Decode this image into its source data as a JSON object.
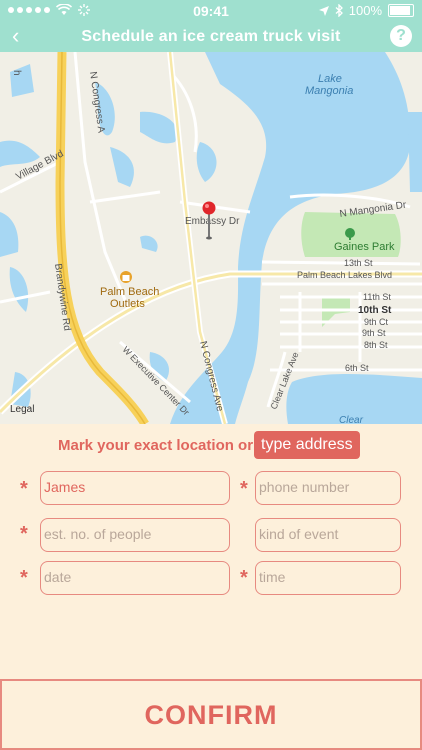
{
  "status_bar": {
    "time": "09:41",
    "battery_text": "100%",
    "battery_level": 1.0
  },
  "nav": {
    "back_icon": "chevron-left-icon",
    "title": "Schedule an ice cream truck visit",
    "help_label": "?"
  },
  "map": {
    "labels": {
      "n_congress_top": "N Congress A",
      "lake_mangonia_1": "Lake",
      "lake_mangonia_2": "Mangonia",
      "village_blvd": "Village Blvd",
      "embassy_dr": "Embassy Dr",
      "n_mangonia_dr": "N Mangonia Dr",
      "gaines_park": "Gaines Park",
      "brandywine_rd": "Brandywine Rd",
      "palm_beach_outlets_1": "Palm Beach",
      "palm_beach_outlets_2": "Outlets",
      "st_13": "13th St",
      "palm_beach_lakes_blvd": "Palm Beach Lakes Blvd",
      "st_11": "11th St",
      "st_10": "10th St",
      "ct_9": "9th Ct",
      "st_9": "9th St",
      "st_8": "8th St",
      "w_executive_center_dr": "W Executive Center Dr",
      "n_congress_ave": "N Congress Ave",
      "st_6": "6th St",
      "clear_lake_ave": "Clear Lake Ave",
      "legal": "Legal",
      "clear": "Clear",
      "edge_h": "h"
    },
    "colors": {
      "water": "#a7d7f3",
      "land": "#f1efe6",
      "park": "#c4e8b5",
      "highway": "#f7d15a",
      "pin": "#e0262b"
    }
  },
  "location_prompt": {
    "text": "Mark your exact location or",
    "type_address_button": "type address"
  },
  "form": {
    "required_mark": "*",
    "name_value": "James",
    "phone_placeholder": "phone number",
    "people_placeholder": "est. no. of people",
    "event_placeholder": "kind of event",
    "date_placeholder": "date",
    "time_placeholder": "time"
  },
  "confirm_label": "CONFIRM",
  "colors": {
    "accent": "#e0665e",
    "header": "#9fe0cf",
    "background": "#fdf0db"
  }
}
